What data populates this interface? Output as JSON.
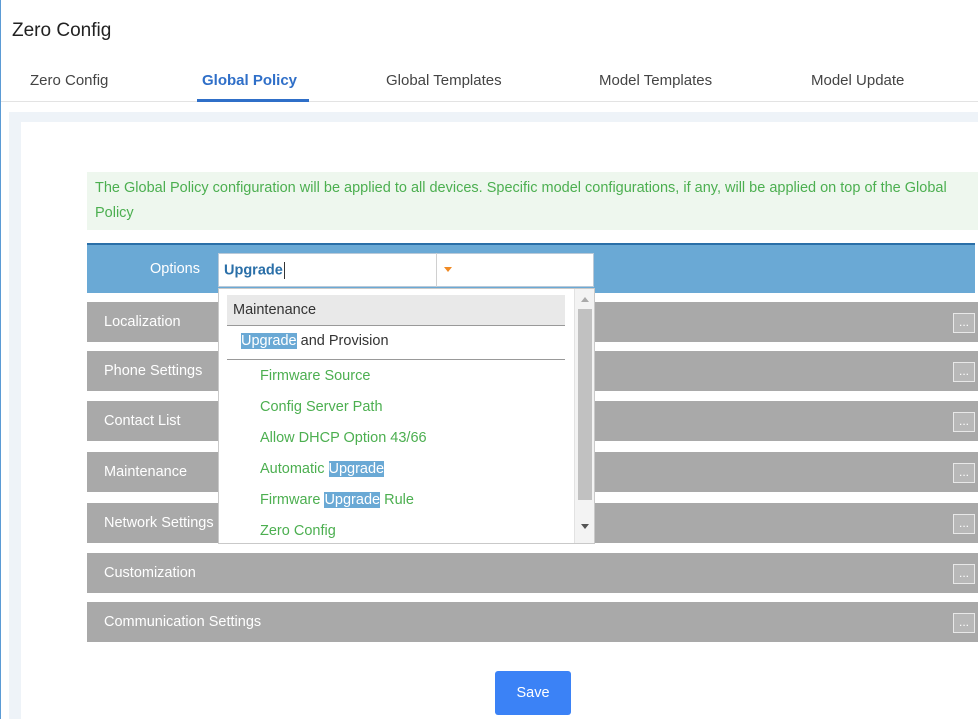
{
  "app": {
    "title": "Zero Config"
  },
  "tabs": [
    {
      "label": "Zero Config"
    },
    {
      "label": "Global Policy"
    },
    {
      "label": "Global Templates"
    },
    {
      "label": "Model Templates"
    },
    {
      "label": "Model Update"
    }
  ],
  "notice": "The Global Policy configuration will be applied to all devices. Specific model configurations, if any, will be applied on top of the Global Policy",
  "options": {
    "label": "Options",
    "value": "Upgrade"
  },
  "sections": [
    {
      "label": "Localization"
    },
    {
      "label": "Phone Settings"
    },
    {
      "label": "Contact List"
    },
    {
      "label": "Maintenance"
    },
    {
      "label": "Network Settings"
    },
    {
      "label": "Customization"
    },
    {
      "label": "Communication Settings"
    }
  ],
  "more_label": "...",
  "dropdown": {
    "group": "Maintenance",
    "subgroup": {
      "match": "Upgrade",
      "rest": " and Provision"
    },
    "items": [
      {
        "text": "Firmware Source"
      },
      {
        "text": "Config Server Path"
      },
      {
        "text": "Allow DHCP Option 43/66"
      },
      {
        "pre": "Automatic ",
        "match": "Upgrade"
      },
      {
        "pre": "Firmware ",
        "match": "Upgrade",
        "post": " Rule"
      },
      {
        "text": "Zero Config"
      }
    ]
  },
  "save_label": "Save",
  "colors": {
    "accent": "#2f6fc8",
    "bar": "#6aa9d5",
    "row": "#a9a9a9",
    "green": "#4caf50",
    "save": "#3b82f6"
  }
}
